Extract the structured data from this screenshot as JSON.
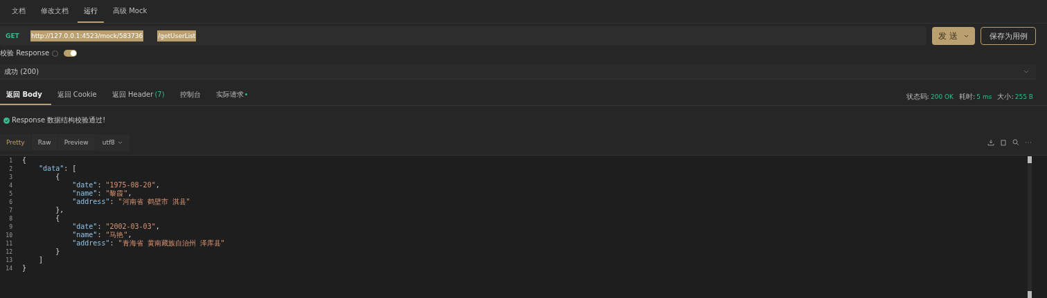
{
  "tabs": [
    {
      "label": "文档",
      "selected": false
    },
    {
      "label": "修改文档",
      "selected": false
    },
    {
      "label": "运行",
      "selected": true
    },
    {
      "label": "高级 Mock",
      "selected": false
    }
  ],
  "request": {
    "method": "GET",
    "url_base": "http://127.0.0.1:4523/mock/583736",
    "url_path": "/getUserList",
    "send_button": "发 送",
    "save_button": "保存为用例"
  },
  "validate": {
    "label": "校验 Response",
    "on": true
  },
  "response_case": {
    "value": "成功 (200)"
  },
  "response_tabs": [
    {
      "label": "返回 Body",
      "selected": true
    },
    {
      "label": "返回 Cookie",
      "selected": false
    },
    {
      "label": "返回 Header",
      "count": "(7)",
      "selected": false
    },
    {
      "label": "控制台",
      "selected": false
    },
    {
      "label": "实际请求",
      "dot": true,
      "selected": false
    }
  ],
  "stats": [
    {
      "label": "状态码:",
      "value": "200 OK"
    },
    {
      "label": "耗时:",
      "value": "5 ms"
    },
    {
      "label": "大小:",
      "value": "255 B"
    }
  ],
  "validation_message": "Response 数据结构校验通过!",
  "format_tabs": [
    {
      "label": "Pretty",
      "selected": true
    },
    {
      "label": "Raw",
      "selected": false
    },
    {
      "label": "Preview",
      "selected": false
    }
  ],
  "encoding": "utf8",
  "code": [
    {
      "number": "1",
      "tokens": [
        {
          "kind": "punct",
          "text": "{"
        }
      ]
    },
    {
      "number": "2",
      "tokens": [
        {
          "kind": "key",
          "text": "    \"data\""
        },
        {
          "kind": "punct",
          "text": ": ["
        }
      ]
    },
    {
      "number": "3",
      "tokens": [
        {
          "kind": "punct",
          "text": "        {"
        }
      ]
    },
    {
      "number": "4",
      "tokens": [
        {
          "kind": "key",
          "text": "            \"date\""
        },
        {
          "kind": "punct",
          "text": ": "
        },
        {
          "kind": "str",
          "text": "\"1975-08-20\""
        },
        {
          "kind": "punct",
          "text": ","
        }
      ]
    },
    {
      "number": "5",
      "tokens": [
        {
          "kind": "key",
          "text": "            \"name\""
        },
        {
          "kind": "punct",
          "text": ": "
        },
        {
          "kind": "str",
          "text": "\"黎霞\""
        },
        {
          "kind": "punct",
          "text": ","
        }
      ]
    },
    {
      "number": "6",
      "tokens": [
        {
          "kind": "key",
          "text": "            \"address\""
        },
        {
          "kind": "punct",
          "text": ": "
        },
        {
          "kind": "str",
          "text": "\"河南省 鹤壁市 淇县\""
        }
      ]
    },
    {
      "number": "7",
      "tokens": [
        {
          "kind": "punct",
          "text": "        },"
        }
      ]
    },
    {
      "number": "8",
      "tokens": [
        {
          "kind": "punct",
          "text": "        {"
        }
      ]
    },
    {
      "number": "9",
      "tokens": [
        {
          "kind": "key",
          "text": "            \"date\""
        },
        {
          "kind": "punct",
          "text": ": "
        },
        {
          "kind": "str",
          "text": "\"2002-03-03\""
        },
        {
          "kind": "punct",
          "text": ","
        }
      ]
    },
    {
      "number": "10",
      "tokens": [
        {
          "kind": "key",
          "text": "            \"name\""
        },
        {
          "kind": "punct",
          "text": ": "
        },
        {
          "kind": "str",
          "text": "\"马艳\""
        },
        {
          "kind": "punct",
          "text": ","
        }
      ]
    },
    {
      "number": "11",
      "tokens": [
        {
          "kind": "key",
          "text": "            \"address\""
        },
        {
          "kind": "punct",
          "text": ": "
        },
        {
          "kind": "str",
          "text": "\"青海省 黄南藏族自治州 泽库县\""
        }
      ]
    },
    {
      "number": "12",
      "tokens": [
        {
          "kind": "punct",
          "text": "        }"
        }
      ]
    },
    {
      "number": "13",
      "tokens": [
        {
          "kind": "punct",
          "text": "    ]"
        }
      ]
    },
    {
      "number": "14",
      "tokens": [
        {
          "kind": "punct",
          "text": "}"
        }
      ]
    }
  ]
}
